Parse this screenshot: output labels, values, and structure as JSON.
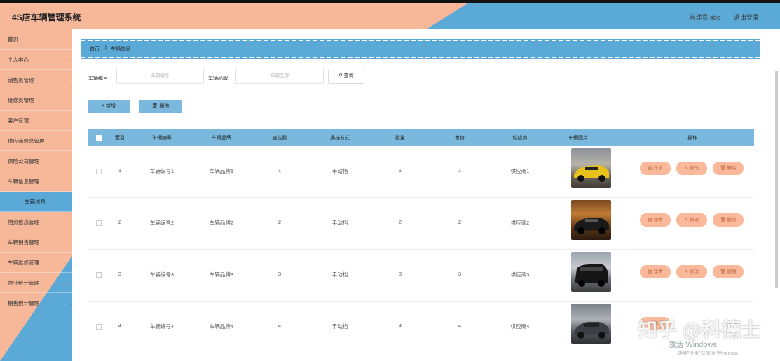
{
  "app_title": "4S店车辆管理系统",
  "header": {
    "admin_label": "管理员 abo",
    "logout_label": "退出登录"
  },
  "sidebar": {
    "items": [
      {
        "label": "首页"
      },
      {
        "label": "个人中心"
      },
      {
        "label": "销售员管理"
      },
      {
        "label": "维修员管理"
      },
      {
        "label": "客户管理"
      },
      {
        "label": "供应商信息管理"
      },
      {
        "label": "保险公司管理"
      },
      {
        "label": "车辆信息管理"
      },
      {
        "label": "车辆信息"
      },
      {
        "label": "物资信息管理"
      },
      {
        "label": "车辆销售管理"
      },
      {
        "label": "车辆维修管理"
      },
      {
        "label": "营业统计管理"
      },
      {
        "label": "销售统计管理"
      }
    ]
  },
  "breadcrumb": {
    "home": "首页",
    "sep": "|",
    "current": "车辆信息"
  },
  "search": {
    "field1_label": "车辆编号",
    "field1_placeholder": "车辆编号",
    "field2_label": "车辆品牌",
    "field2_placeholder": "车辆品牌",
    "query_label": "查询",
    "query_icon": "search-icon"
  },
  "actions": {
    "add_label": "新增",
    "add_icon": "plus-icon",
    "delete_label": "删除",
    "delete_icon": "trash-icon"
  },
  "table": {
    "headers": [
      "索引",
      "车辆编号",
      "车辆品牌",
      "座位数",
      "换挡方式",
      "数量",
      "售价",
      "供应商",
      "车辆图片",
      "操作"
    ],
    "rows": [
      {
        "index": "1",
        "code": "车辆编号1",
        "brand": "车辆品牌1",
        "seats": "1",
        "gear": "手动挡",
        "qty": "1",
        "price": "1",
        "supplier": "供应商1",
        "image": "yellow-sports-car"
      },
      {
        "index": "2",
        "code": "车辆编号2",
        "brand": "车辆品牌2",
        "seats": "2",
        "gear": "手动挡",
        "qty": "2",
        "price": "2",
        "supplier": "供应商2",
        "image": "black-sports-car"
      },
      {
        "index": "3",
        "code": "车辆编号3",
        "brand": "车辆品牌3",
        "seats": "3",
        "gear": "手动挡",
        "qty": "3",
        "price": "3",
        "supplier": "供应商3",
        "image": "black-suv"
      },
      {
        "index": "4",
        "code": "车辆编号4",
        "brand": "车辆品牌4",
        "seats": "4",
        "gear": "手动挡",
        "qty": "4",
        "price": "4",
        "supplier": "供应商4",
        "image": "gray-sedan"
      }
    ],
    "row_actions": {
      "detail": "详情",
      "edit": "修改",
      "delete": "删除"
    }
  },
  "overlay": {
    "watermark": "知乎 @科德士",
    "windows_line1": "激活 Windows",
    "windows_line2": "转到\"设置\"以激活 Windows。"
  },
  "colors": {
    "salmon": "#f7b89a",
    "blue": "#5aa9d6",
    "table_header": "#7ab9dd"
  }
}
